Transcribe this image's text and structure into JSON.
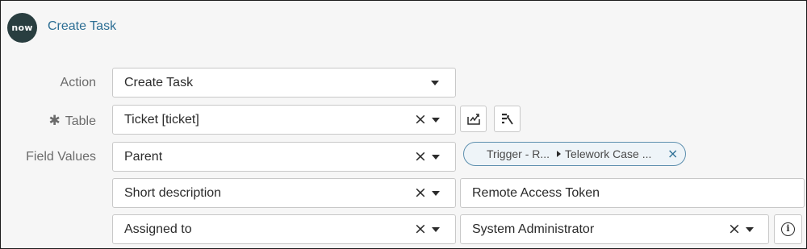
{
  "header": {
    "logo_text": "now",
    "title": "Create Task"
  },
  "form": {
    "action": {
      "label": "Action",
      "value": "Create Task"
    },
    "table": {
      "required_marker": "✱",
      "label": "Table",
      "value": "Ticket [ticket]"
    },
    "field_values": {
      "label": "Field Values",
      "rows": [
        {
          "field": "Parent",
          "value_pill": {
            "segment1": "Trigger - R...",
            "segment2": "Telework Case ..."
          }
        },
        {
          "field": "Short description",
          "value": "Remote Access Token"
        },
        {
          "field": "Assigned to",
          "value": "System Administrator"
        }
      ]
    }
  },
  "icons": {
    "clear": "×",
    "caret": "chevron-down-icon",
    "pill_remove": "×",
    "info": "i"
  }
}
